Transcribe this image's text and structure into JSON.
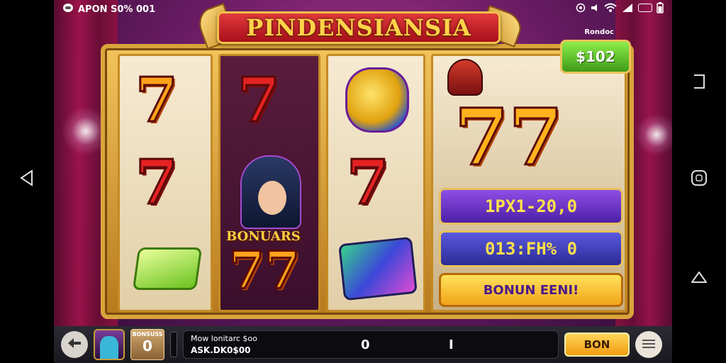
{
  "status_bar": {
    "left_text": "APON S0% 001"
  },
  "title": "PINDENSIANSIA",
  "balance": {
    "caption": "Rondoc",
    "value": "$102"
  },
  "reels": {
    "bonus_label": "BONUARS"
  },
  "panels": {
    "win_line": "1PX1-20,0",
    "multiplier": "013:FH% 0",
    "bonus_button": "BONUN EENI!"
  },
  "bottom_bar": {
    "bonus_card_label": "BONSUSS",
    "bonus_card_value": "0",
    "msg_line1": "Mow lonitarc $oo",
    "msg_line2": "ASK.DK0$00",
    "msg_center": "0",
    "msg_right": "I",
    "spin_label": "BON"
  },
  "icons": [
    "android-back-icon",
    "android-home-icon",
    "android-recents-icon",
    "back-arrow-icon",
    "menu-icon",
    "sim-icon",
    "wifi-icon",
    "signal-icon",
    "battery-icon"
  ],
  "colors": {
    "banner_red": "#c01824",
    "gold": "#f4c24a",
    "panel_purple": "#6a36c8",
    "spin_gold": "#f5b225"
  }
}
